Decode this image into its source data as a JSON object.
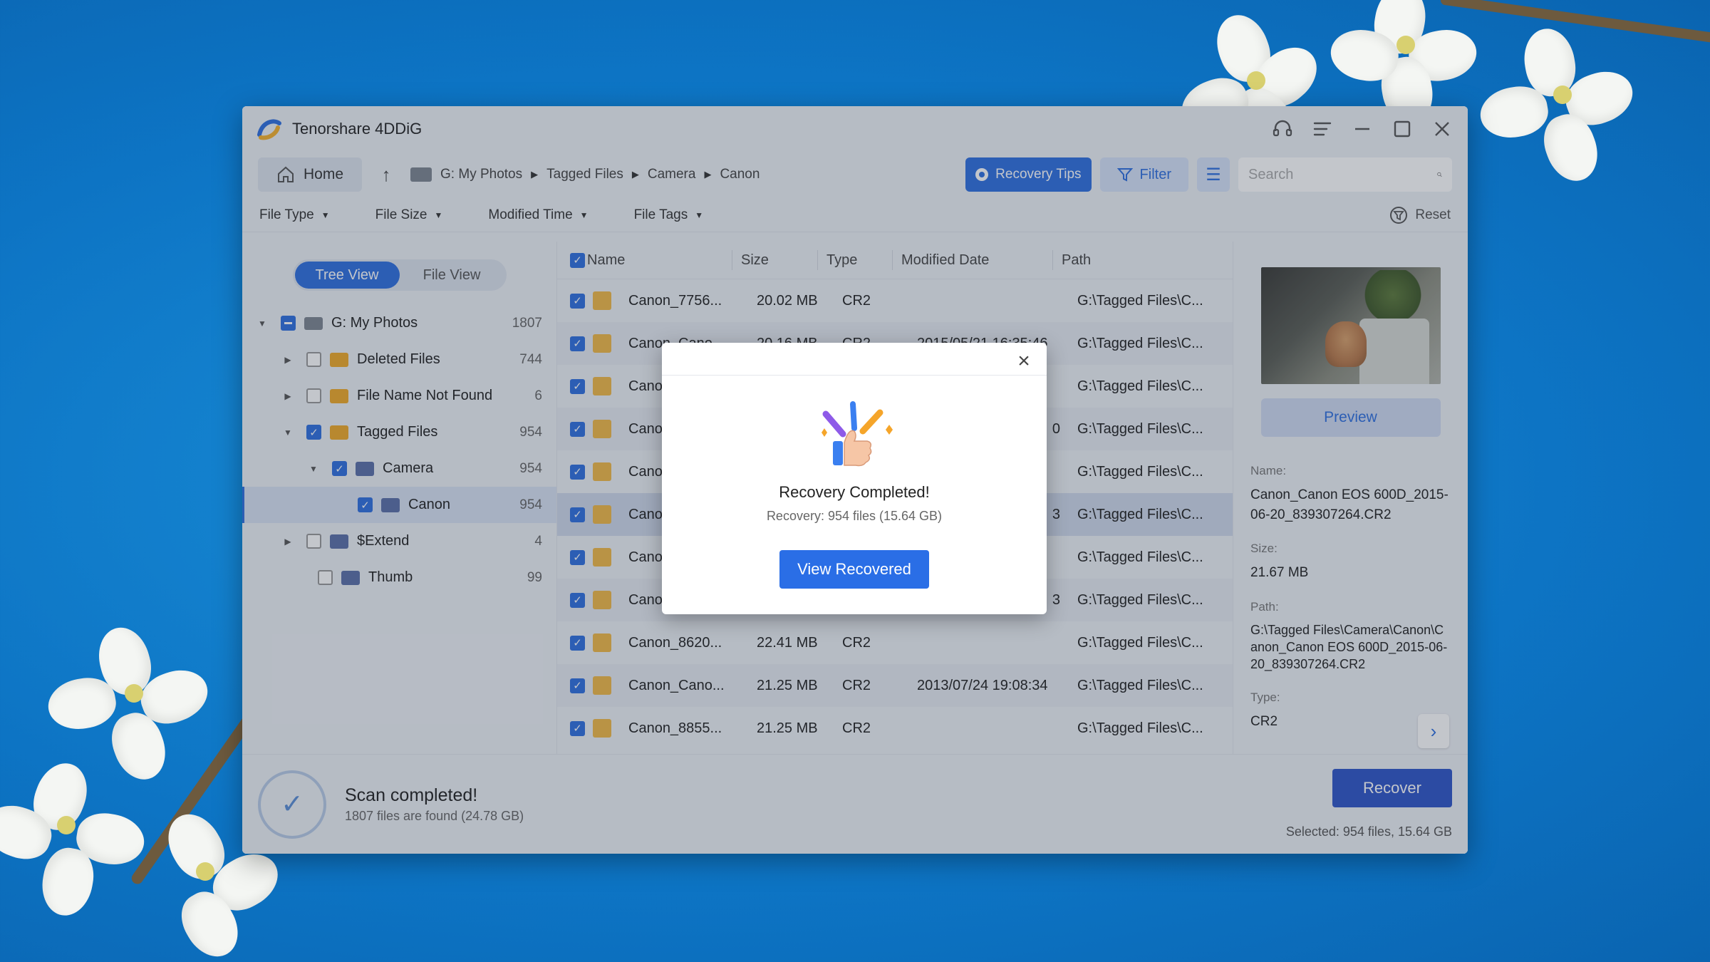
{
  "app": {
    "title": "Tenorshare 4DDiG"
  },
  "toolbar": {
    "home_label": "Home",
    "breadcrumb": [
      "G: My Photos",
      "Tagged Files",
      "Camera",
      "Canon"
    ],
    "recovery_tips_label": "Recovery Tips",
    "filter_label": "Filter",
    "search_placeholder": "Search"
  },
  "filters": {
    "items": [
      "File Type",
      "File Size",
      "Modified Time",
      "File Tags"
    ],
    "reset_label": "Reset"
  },
  "sidebar": {
    "views": [
      "Tree View",
      "File View"
    ],
    "active_view": "Tree View",
    "tree": [
      {
        "label": "G: My Photos",
        "count": "1807"
      },
      {
        "label": "Deleted Files",
        "count": "744"
      },
      {
        "label": "File Name Not Found",
        "count": "6"
      },
      {
        "label": "Tagged Files",
        "count": "954"
      },
      {
        "label": "Camera",
        "count": "954"
      },
      {
        "label": "Canon",
        "count": "954"
      },
      {
        "label": "$Extend",
        "count": "4"
      },
      {
        "label": "Thumb",
        "count": "99"
      }
    ]
  },
  "table": {
    "headers": [
      "Name",
      "Size",
      "Type",
      "Modified Date",
      "Path"
    ],
    "rows": [
      {
        "name": "Canon_7756...",
        "size": "20.02 MB",
        "type": "CR2",
        "date": "",
        "path": "G:\\Tagged Files\\C..."
      },
      {
        "name": "Canon_Cano...",
        "size": "20.16 MB",
        "type": "CR2",
        "date": "2015/05/21 16:35:46",
        "path": "G:\\Tagged Files\\C..."
      },
      {
        "name": "Canon...",
        "size": "",
        "type": "",
        "date": "",
        "path": "G:\\Tagged Files\\C..."
      },
      {
        "name": "Canon...",
        "size": "",
        "type": "",
        "date": "0",
        "path": "G:\\Tagged Files\\C..."
      },
      {
        "name": "Canon...",
        "size": "",
        "type": "",
        "date": "",
        "path": "G:\\Tagged Files\\C..."
      },
      {
        "name": "Canon...",
        "size": "",
        "type": "",
        "date": "3",
        "path": "G:\\Tagged Files\\C..."
      },
      {
        "name": "Canon...",
        "size": "",
        "type": "",
        "date": "",
        "path": "G:\\Tagged Files\\C..."
      },
      {
        "name": "Canon...",
        "size": "",
        "type": "",
        "date": "3",
        "path": "G:\\Tagged Files\\C..."
      },
      {
        "name": "Canon_8620...",
        "size": "22.41 MB",
        "type": "CR2",
        "date": "",
        "path": "G:\\Tagged Files\\C..."
      },
      {
        "name": "Canon_Cano...",
        "size": "21.25 MB",
        "type": "CR2",
        "date": "2013/07/24 19:08:34",
        "path": "G:\\Tagged Files\\C..."
      },
      {
        "name": "Canon_8855...",
        "size": "21.25 MB",
        "type": "CR2",
        "date": "",
        "path": "G:\\Tagged Files\\C..."
      }
    ]
  },
  "details": {
    "preview_label": "Preview",
    "name_label": "Name:",
    "name_value": "Canon_Canon EOS 600D_2015-06-20_839307264.CR2",
    "size_label": "Size:",
    "size_value": "21.67 MB",
    "path_label": "Path:",
    "path_value": "G:\\Tagged Files\\Camera\\Canon\\Canon_Canon EOS 600D_2015-06-20_839307264.CR2",
    "type_label": "Type:",
    "type_value": "CR2"
  },
  "footer": {
    "scan_title": "Scan completed!",
    "scan_sub": "1807 files are found (24.78 GB)",
    "recover_label": "Recover",
    "selected_info": "Selected: 954 files, 15.64 GB"
  },
  "modal": {
    "title": "Recovery Completed!",
    "subtitle": "Recovery: 954 files (15.64 GB)",
    "button_label": "View Recovered"
  },
  "colors": {
    "accent": "#2f6fe0",
    "recover": "#2f55c8",
    "background": "#0d74c4"
  }
}
